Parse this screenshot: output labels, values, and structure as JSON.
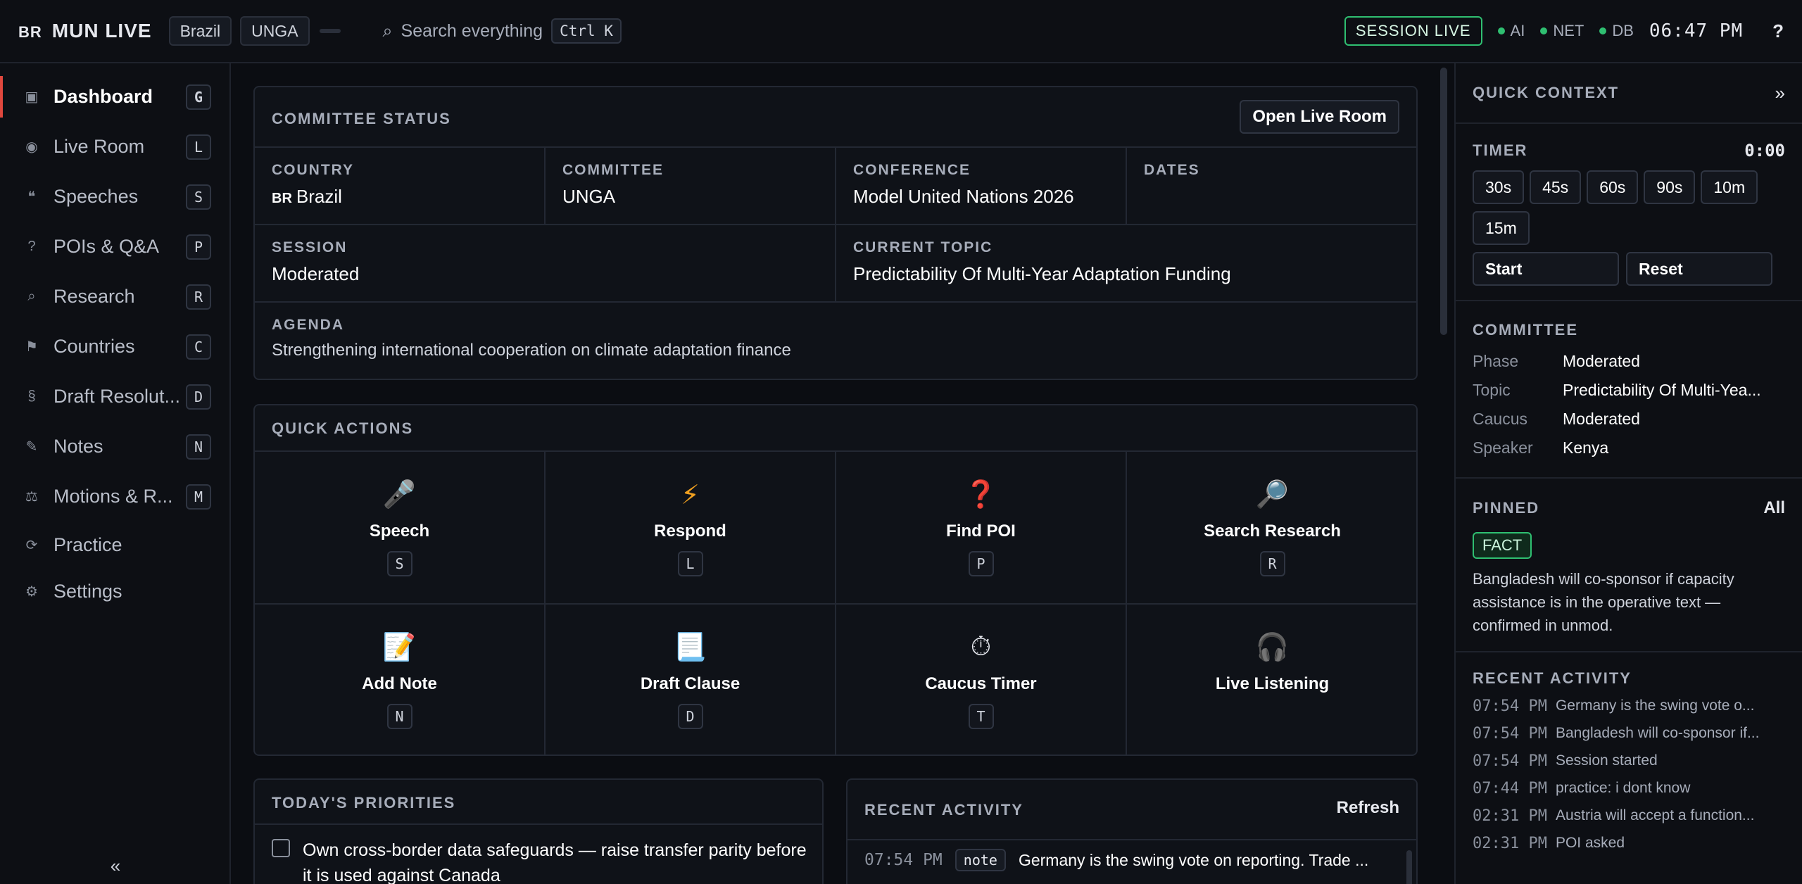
{
  "topbar": {
    "country_code": "BR",
    "app_name": "MUN LIVE",
    "country_pill": "Brazil",
    "committee_pill": "UNGA",
    "search_placeholder": "Search everything",
    "search_shortcut": "Ctrl K",
    "session_badge": "SESSION LIVE",
    "status_ai": "AI",
    "status_net": "NET",
    "status_db": "DB",
    "clock": "06:47 PM",
    "help": "?",
    "status_color": "#2fbf71"
  },
  "sidebar": {
    "items": [
      {
        "icon": "▣",
        "label": "Dashboard",
        "key": "G"
      },
      {
        "icon": "◉",
        "label": "Live Room",
        "key": "L"
      },
      {
        "icon": "❝",
        "label": "Speeches",
        "key": "S"
      },
      {
        "icon": "?",
        "label": "POIs & Q&A",
        "key": "P"
      },
      {
        "icon": "⌕",
        "label": "Research",
        "key": "R"
      },
      {
        "icon": "⚑",
        "label": "Countries",
        "key": "C"
      },
      {
        "icon": "§",
        "label": "Draft Resolut...",
        "key": "D"
      },
      {
        "icon": "✎",
        "label": "Notes",
        "key": "N"
      },
      {
        "icon": "⚖",
        "label": "Motions & R...",
        "key": "M"
      },
      {
        "icon": "⟳",
        "label": "Practice",
        "key": ""
      },
      {
        "icon": "⚙",
        "label": "Settings",
        "key": ""
      }
    ],
    "collapse": "«"
  },
  "committee_status": {
    "title": "COMMITTEE STATUS",
    "open_button": "Open Live Room",
    "country_label": "COUNTRY",
    "country_code": "BR",
    "country_value": "Brazil",
    "committee_label": "COMMITTEE",
    "committee_value": "UNGA",
    "conference_label": "CONFERENCE",
    "conference_value": "Model United Nations 2026",
    "dates_label": "DATES",
    "dates_value": "",
    "session_label": "SESSION",
    "session_value": "Moderated",
    "topic_label": "CURRENT TOPIC",
    "topic_value": "Predictability Of Multi-Year Adaptation Funding",
    "agenda_label": "AGENDA",
    "agenda_value": "Strengthening international cooperation on climate adaptation finance"
  },
  "quick_actions": {
    "title": "QUICK ACTIONS",
    "items": [
      {
        "icon": "🎤",
        "label": "Speech",
        "key": "S"
      },
      {
        "icon": "⚡",
        "label": "Respond",
        "key": "L"
      },
      {
        "icon": "❓",
        "label": "Find POI",
        "key": "P"
      },
      {
        "icon": "🔎",
        "label": "Search Research",
        "key": "R"
      },
      {
        "icon": "📝",
        "label": "Add Note",
        "key": "N"
      },
      {
        "icon": "📃",
        "label": "Draft Clause",
        "key": "D"
      },
      {
        "icon": "⏱",
        "label": "Caucus Timer",
        "key": "T"
      },
      {
        "icon": "🎧",
        "label": "Live Listening",
        "key": ""
      }
    ]
  },
  "priorities": {
    "title": "TODAY'S PRIORITIES",
    "items": [
      {
        "text": "Own cross-border data safeguards — raise transfer parity before it is used against Canada"
      }
    ]
  },
  "recent_activity_main": {
    "title": "RECENT ACTIVITY",
    "refresh": "Refresh",
    "items": [
      {
        "time": "07:54 PM",
        "tag": "note",
        "text": "Germany is the swing vote on reporting. Trade ..."
      }
    ]
  },
  "quick_context": {
    "title": "QUICK CONTEXT",
    "collapse": "»",
    "timer_label": "TIMER",
    "timer_value": "0:00",
    "presets": [
      "30s",
      "45s",
      "60s",
      "90s",
      "10m",
      "15m"
    ],
    "start": "Start",
    "reset": "Reset",
    "committee_title": "COMMITTEE",
    "committee_rows": [
      {
        "k": "Phase",
        "v": "Moderated"
      },
      {
        "k": "Topic",
        "v": "Predictability Of Multi-Yea..."
      },
      {
        "k": "Caucus",
        "v": "Moderated"
      },
      {
        "k": "Speaker",
        "v": "Kenya"
      }
    ],
    "pinned_title": "PINNED",
    "pinned_all": "All",
    "pinned_tag": "FACT",
    "pinned_text": "Bangladesh will co-sponsor if capacity assistance is in the operative text — confirmed in unmod.",
    "recent_title": "RECENT ACTIVITY",
    "recent": [
      {
        "t": "07:54 PM",
        "x": "Germany is the swing vote o..."
      },
      {
        "t": "07:54 PM",
        "x": "Bangladesh will co-sponsor if..."
      },
      {
        "t": "07:54 PM",
        "x": "Session started"
      },
      {
        "t": "07:44 PM",
        "x": "practice: i dont know"
      },
      {
        "t": "02:31 PM",
        "x": "Austria will accept a function..."
      },
      {
        "t": "02:31 PM",
        "x": "POI asked"
      }
    ]
  }
}
